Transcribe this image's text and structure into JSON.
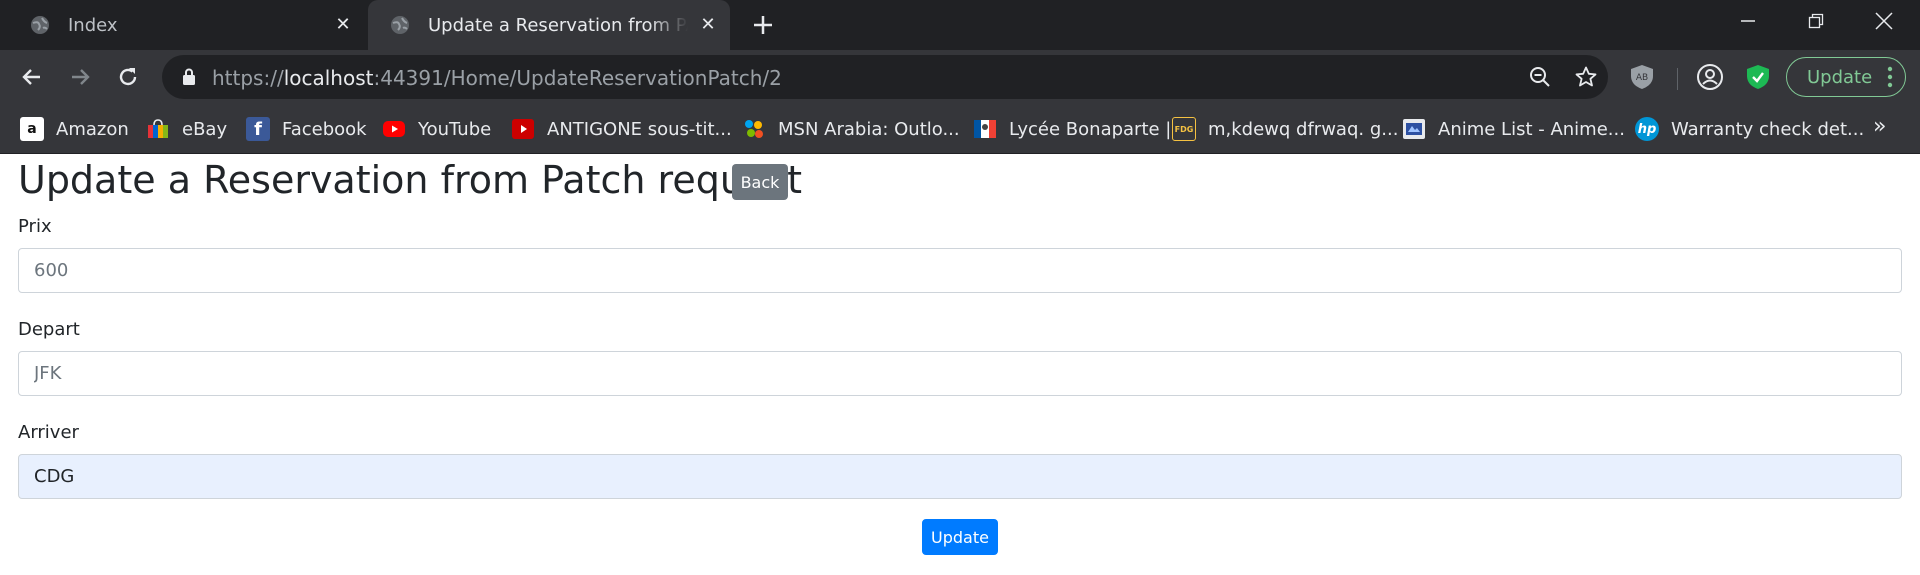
{
  "browser": {
    "tabs": [
      {
        "title": "Index",
        "active": false
      },
      {
        "title": "Update a Reservation from PATCH",
        "active": true
      }
    ],
    "url": {
      "scheme": "https://",
      "host": "localhost",
      "rest": ":44391/Home/UpdateReservationPatch/2"
    },
    "update_button_label": "Update",
    "colors": {
      "frame": "#202124",
      "toolbar": "#35363a",
      "accent_green": "#81c995"
    },
    "bookmarks": [
      {
        "label": "Amazon",
        "icon": "amazon-icon"
      },
      {
        "label": "eBay",
        "icon": "ebay-icon"
      },
      {
        "label": "Facebook",
        "icon": "facebook-icon"
      },
      {
        "label": "YouTube",
        "icon": "youtube-icon"
      },
      {
        "label": "ANTIGONE sous-tit...",
        "icon": "youtube-icon"
      },
      {
        "label": "MSN Arabia: Outlo...",
        "icon": "msn-icon"
      },
      {
        "label": "Lycée Bonaparte |",
        "icon": "lycee-icon"
      },
      {
        "label": "m,kdewq dfrwaq. g...",
        "icon": "fdg-icon"
      },
      {
        "label": "Anime List - Anime...",
        "icon": "anime-icon"
      },
      {
        "label": "Warranty check det...",
        "icon": "hp-icon"
      }
    ],
    "bookmarks_overflow": "»"
  },
  "page": {
    "title": "Update a Reservation from Patch request",
    "back_label": "Back",
    "fields": [
      {
        "label": "Prix",
        "value": "600"
      },
      {
        "label": "Depart",
        "value": "JFK"
      },
      {
        "label": "Arriver",
        "value": "CDG"
      }
    ],
    "submit_label": "Update",
    "colors": {
      "primary": "#007bff",
      "secondary": "#6c757d",
      "autofill_bg": "#e8f0fe"
    }
  }
}
